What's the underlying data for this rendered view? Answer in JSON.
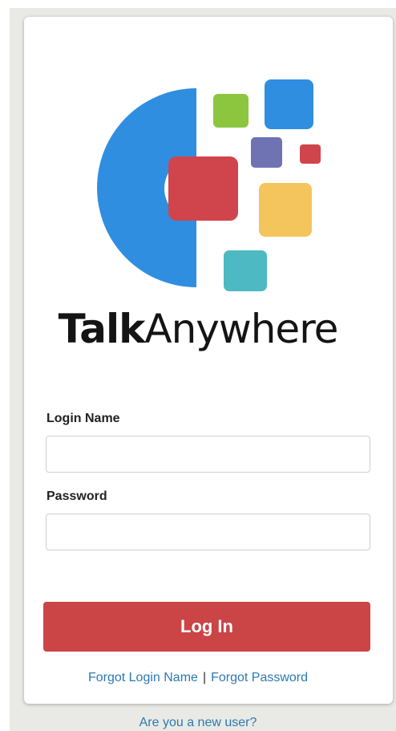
{
  "brand": {
    "name_bold": "Talk",
    "name_light": "Anywhere",
    "colors": {
      "blue": "#2f8ee0",
      "green": "#8cc63f",
      "lightblue": "#2f8ee0",
      "purple": "#6f73b3",
      "red": "#d0454b",
      "yellow": "#f4c55c",
      "teal": "#4db9c3"
    }
  },
  "form": {
    "login_name_label": "Login Name",
    "login_name_value": "",
    "password_label": "Password",
    "password_value": "",
    "login_button": "Log In"
  },
  "links": {
    "forgot_login": "Forgot Login Name",
    "separator": "|",
    "forgot_password": "Forgot Password",
    "new_user": "Are you a new user?"
  },
  "theme": {
    "button_color": "#cb4446",
    "link_color": "#2d78b3"
  }
}
